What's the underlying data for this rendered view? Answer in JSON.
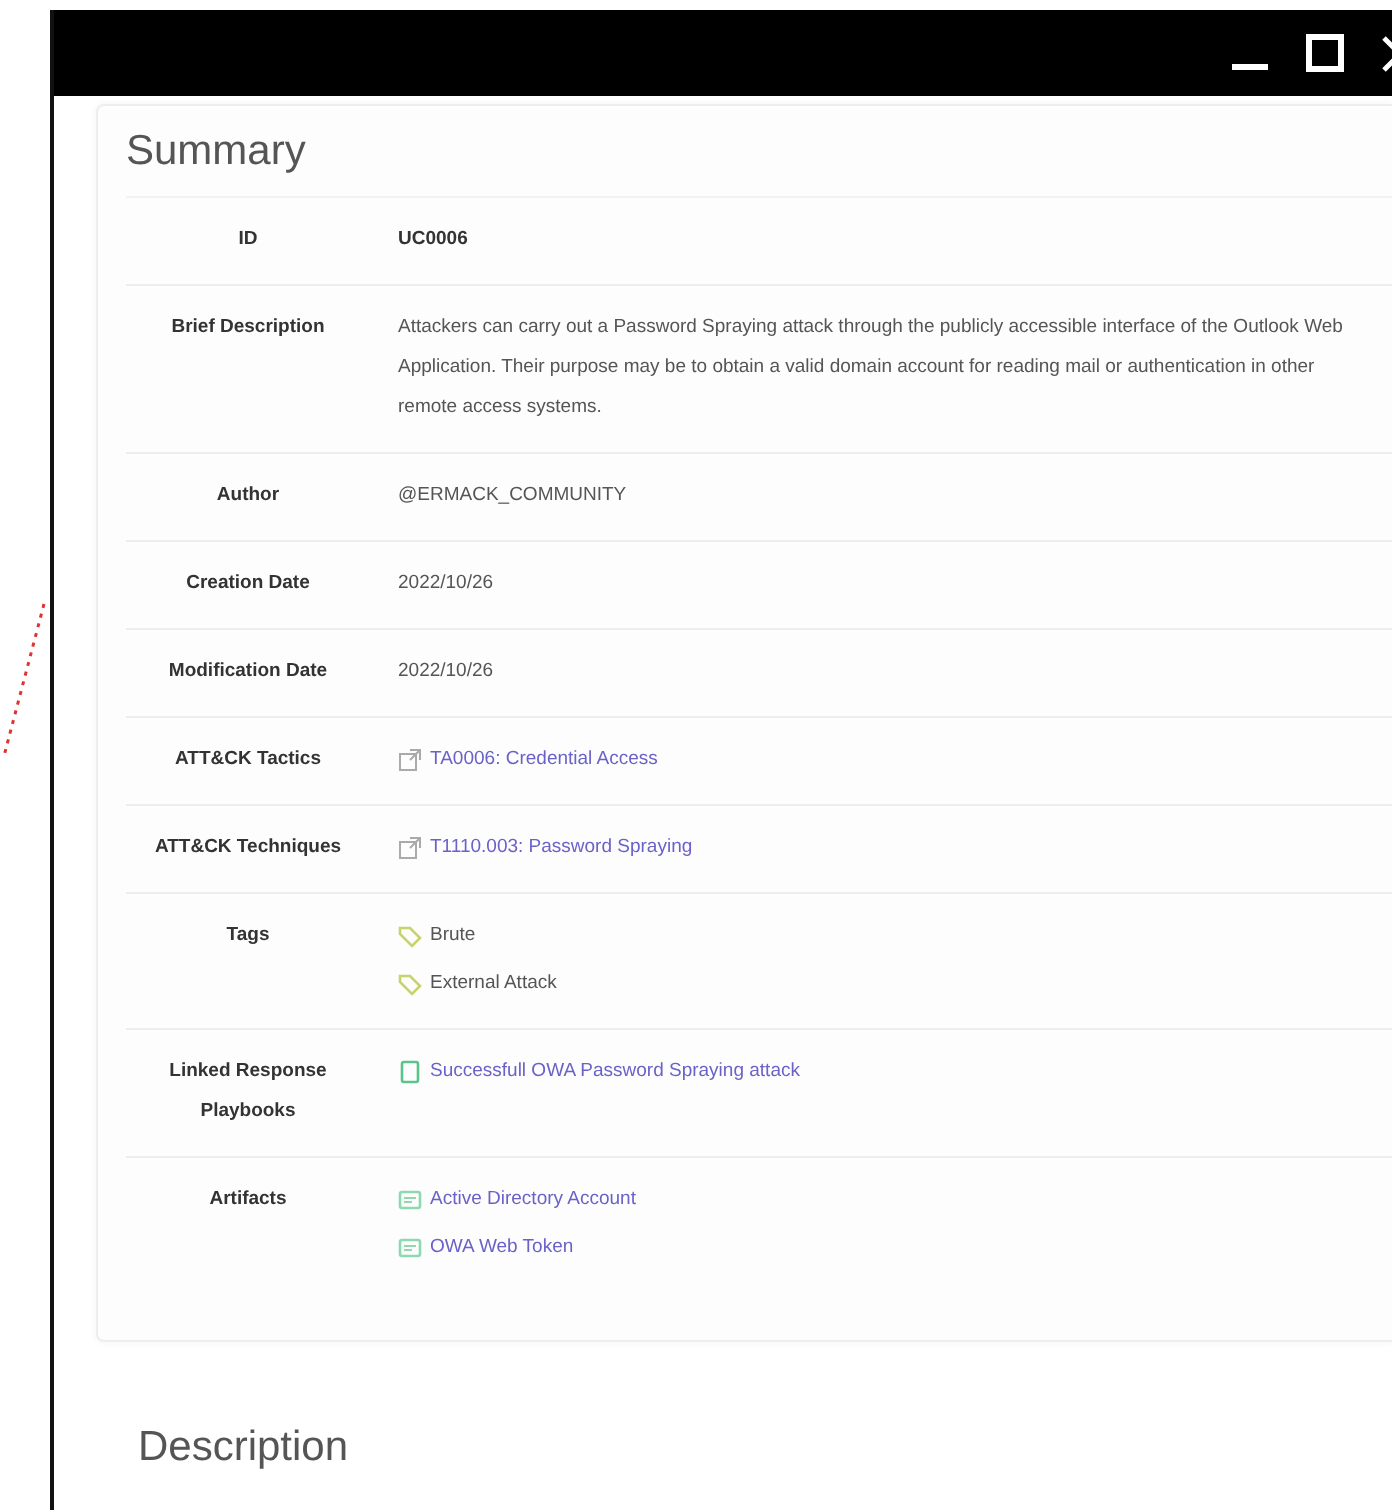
{
  "summary": {
    "title": "Summary",
    "rows": [
      {
        "label": "ID",
        "kind": "bold",
        "values": [
          "UC0006"
        ]
      },
      {
        "label": "Brief Description",
        "kind": "text",
        "values": [
          "Attackers can carry out a Password Spraying attack through the publicly accessible interface of the Outlook Web Application. Their purpose may be to obtain a valid domain account for reading mail or authentication in other remote access systems."
        ]
      },
      {
        "label": "Author",
        "kind": "text",
        "values": [
          "@ERMACK_COMMUNITY"
        ]
      },
      {
        "label": "Creation Date",
        "kind": "text",
        "values": [
          "2022/10/26"
        ]
      },
      {
        "label": "Modification Date",
        "kind": "text",
        "values": [
          "2022/10/26"
        ]
      },
      {
        "label": "ATT&CK Tactics",
        "kind": "external",
        "values": [
          "TA0006: Credential Access"
        ]
      },
      {
        "label": "ATT&CK Techniques",
        "kind": "external",
        "values": [
          "T1110.003: Password Spraying"
        ]
      },
      {
        "label": "Tags",
        "kind": "tag",
        "values": [
          "Brute",
          "External Attack"
        ]
      },
      {
        "label": "Linked Response Playbooks",
        "kind": "playbook",
        "values": [
          "Successfull OWA Password Spraying attack"
        ]
      },
      {
        "label": "Artifacts",
        "kind": "artifact",
        "values": [
          "Active Directory Account",
          "OWA Web Token"
        ]
      }
    ]
  },
  "description": {
    "title": "Description"
  }
}
